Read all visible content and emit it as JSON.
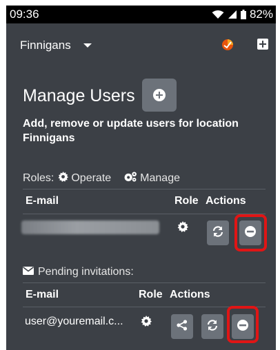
{
  "status_bar": {
    "time": "09:36",
    "battery": "82%"
  },
  "app_bar": {
    "location": "Finnigans"
  },
  "page": {
    "title": "Manage Users",
    "description": "Add, remove or update users for location Finnigans"
  },
  "roles": {
    "prefix": "Roles:",
    "operate": "Operate",
    "manage": "Manage"
  },
  "users_table": {
    "headers": {
      "email": "E-mail",
      "role": "Role",
      "actions": "Actions"
    },
    "rows": [
      {
        "email": "",
        "role_icon": "gear-icon"
      }
    ]
  },
  "pending": {
    "label": "Pending invitations:",
    "headers": {
      "email": "E-mail",
      "role": "Role",
      "actions": "Actions"
    },
    "rows": [
      {
        "email": "user@youremail.c...",
        "role_icon": "gear-icon"
      }
    ]
  },
  "colors": {
    "background": "#3c4046",
    "button": "#6c727a",
    "highlight": "#e01515"
  }
}
